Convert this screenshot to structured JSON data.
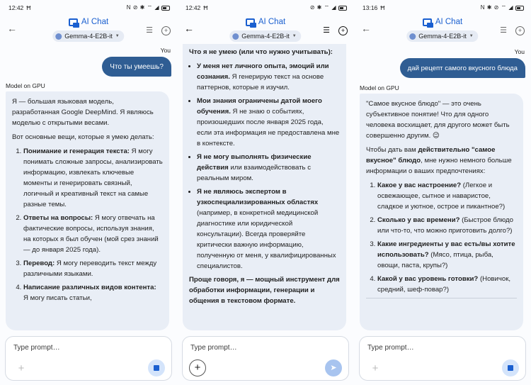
{
  "app": {
    "title": "AI Chat",
    "input_placeholder": "Type prompt…"
  },
  "labels": {
    "you": "You",
    "model": "Model on GPU"
  },
  "icons": {
    "back": "arrow-back-icon",
    "tune": "tune-icon",
    "new_chat": "new-chat-icon",
    "plus": "plus-icon",
    "stop": "stop-icon",
    "send": "send-icon"
  },
  "colors": {
    "accent": "#1a5fd0",
    "user_bubble": "#2f5d93",
    "model_bubble": "#e9eef6"
  },
  "screens": [
    {
      "status_time": "12:42",
      "status_left_icon": "Ħ",
      "status_right": "N ⊘ ✱ ⌔ ◢",
      "model_chip": "Gemma-4-E2B-it",
      "user_message": "Что ты умеешь?",
      "model_intro_1": "Я — большая языковая модель, разработанная Google DeepMind. Я являюсь моделью с открытыми весами.",
      "model_intro_2": "Вот основные вещи, которые я умею делать:",
      "items": [
        {
          "bold": "Понимание и генерация текста:",
          "text": " Я могу понимать сложные запросы, анализировать информацию, извлекать ключевые моменты и генерировать связный, логичный и креативный текст на самые разные темы."
        },
        {
          "bold": "Ответы на вопросы:",
          "text": " Я могу отвечать на фактические вопросы, используя знания, на которых я был обучен (мой срез знаний — до января 2025 года)."
        },
        {
          "bold": "Перевод:",
          "text": " Я могу переводить текст между различными языками."
        },
        {
          "bold": "Написание различных видов контента:",
          "text": " Я могу писать статьи,"
        }
      ]
    },
    {
      "status_time": "12:42",
      "status_left_icon": "Ħ",
      "status_right": "⊘ ✱ ⌔ ◢",
      "model_chip": "Gemma-4-E2B-it",
      "heading": "Что я не умею (или что нужно учитывать):",
      "items": [
        {
          "bold": "У меня нет личного опыта, эмоций или сознания.",
          "text": " Я генерирую текст на основе паттернов, которые я изучил."
        },
        {
          "bold": "Мои знания ограничены датой моего обучения.",
          "text": " Я не знаю о событиях, произошедших после января 2025 года, если эта информация не предоставлена мне в контексте."
        },
        {
          "bold": "Я не могу выполнять физические действия",
          "text": " или взаимодействовать с реальным миром."
        },
        {
          "bold": "Я не являюсь экспертом в узкоспециализированных областях",
          "text": " (например, в конкретной медицинской диагностике или юридической консультации). Всегда проверяйте критически важную информацию, полученную от меня, у квалифицированных специалистов."
        }
      ],
      "closing": "Проще говоря, я — мощный инструмент для обработки информации, генерации и общения в текстовом формате."
    },
    {
      "status_time": "13:16",
      "status_left_icon": "Ħ",
      "status_right": "N ✱ ⊘ ⌔ ◢",
      "model_chip": "Gemma-4-E2B-it",
      "user_message": "дай рецепт самого вкусного блюда",
      "intro_1": "\"Самое вкусное блюдо\" — это очень субъективное понятие! Что для одного человека восхищает, для другого может быть совершенно другим. 😉",
      "intro_2_pre": "Чтобы дать вам ",
      "intro_2_bold": "действительно \"самое вкусное\" блюдо",
      "intro_2_post": ", мне нужно немного больше информации о ваших предпочтениях:",
      "items": [
        {
          "bold": "Какое у вас настроение?",
          "text": " (Легкое и освежающее, сытное и наваристое, сладкое и уютное, острое и пикантное?)"
        },
        {
          "bold": "Сколько у вас времени?",
          "text": " (Быстрое блюдо или что-то, что можно приготовить долго?)"
        },
        {
          "bold": "Какие ингредиенты у вас есть/вы хотите использовать?",
          "text": " (Мясо, птица, рыба, овощи, паста, крупы?)"
        },
        {
          "bold": "Какой у вас уровень готовки?",
          "text": " (Новичок, средний, шеф-повар?)"
        }
      ]
    }
  ]
}
